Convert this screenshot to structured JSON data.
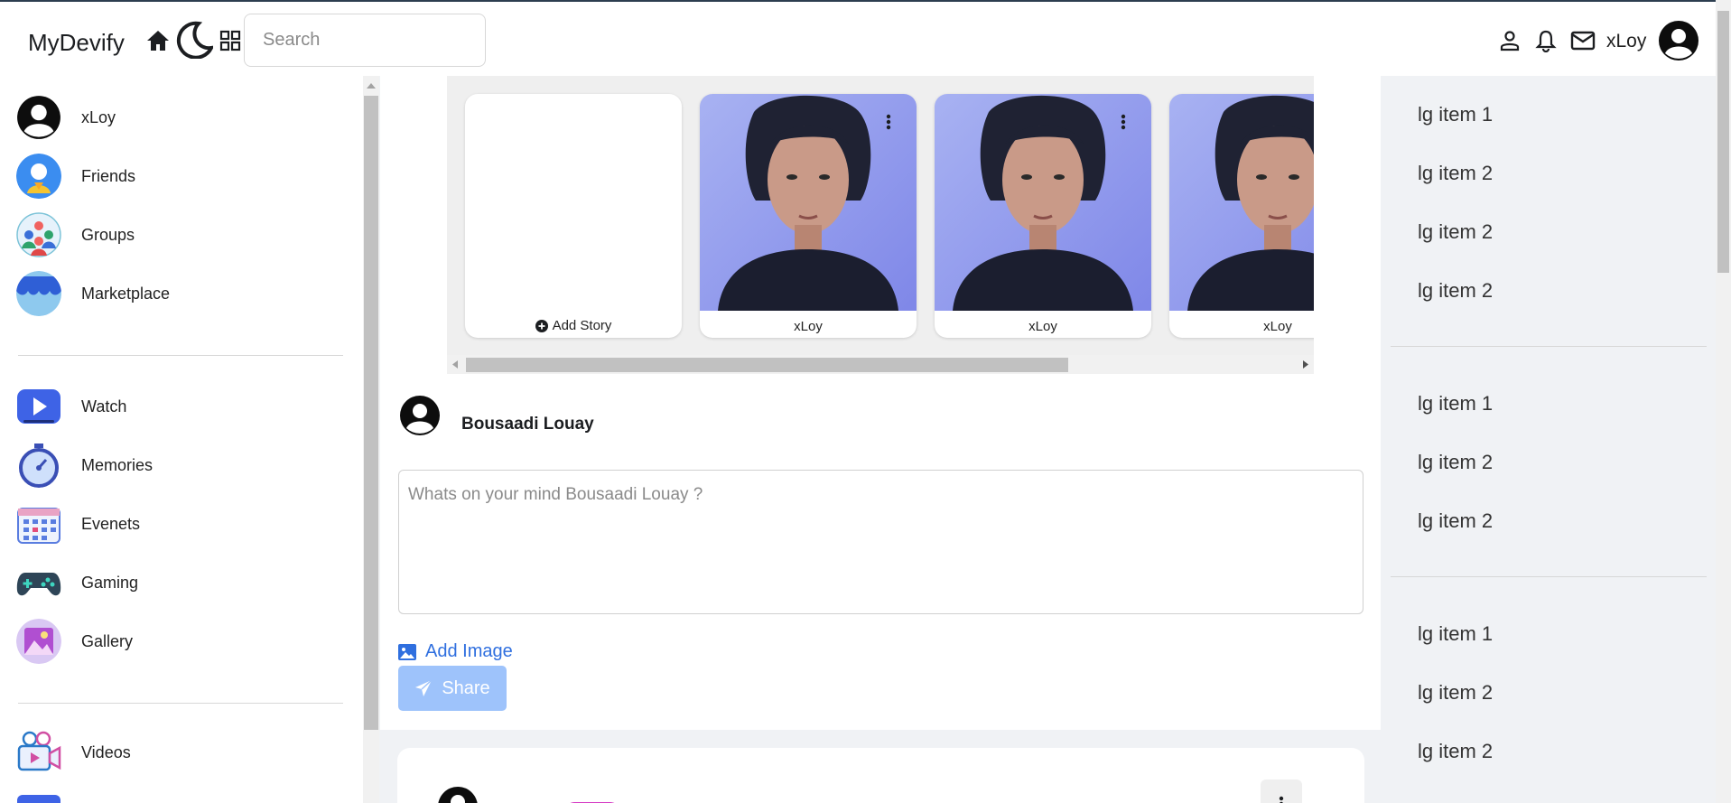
{
  "header": {
    "brand": "MyDevify",
    "search_placeholder": "Search",
    "username": "xLoy",
    "icons": [
      "home-icon",
      "moon-icon",
      "apps-grid-icon",
      "person-icon",
      "bell-icon",
      "mail-icon",
      "avatar-icon"
    ]
  },
  "sidebar": {
    "items": [
      {
        "label": "xLoy",
        "icon": "user-avatar"
      },
      {
        "label": "Friends",
        "icon": "friends-icon"
      },
      {
        "label": "Groups",
        "icon": "groups-icon"
      },
      {
        "label": "Marketplace",
        "icon": "marketplace-icon"
      },
      {
        "label": "Watch",
        "icon": "watch-icon"
      },
      {
        "label": "Memories",
        "icon": "memories-icon"
      },
      {
        "label": "Evenets",
        "icon": "events-icon"
      },
      {
        "label": "Gaming",
        "icon": "gaming-icon"
      },
      {
        "label": "Gallery",
        "icon": "gallery-icon"
      },
      {
        "label": "Videos",
        "icon": "videos-icon"
      }
    ]
  },
  "stories": {
    "add_label": "Add Story",
    "items": [
      {
        "name": "xLoy"
      },
      {
        "name": "xLoy"
      },
      {
        "name": "xLoy"
      }
    ]
  },
  "composer": {
    "author": "Bousaadi Louay",
    "placeholder": "Whats on your mind Bousaadi Louay ?",
    "add_image_label": "Add Image",
    "share_label": "Share"
  },
  "rightbar": {
    "groups": [
      [
        "lg item 1",
        "lg item 2",
        "lg item 2",
        "lg item 2"
      ],
      [
        "lg item 1",
        "lg item 2",
        "lg item 2"
      ],
      [
        "lg item 1",
        "lg item 2",
        "lg item 2"
      ]
    ]
  },
  "colors": {
    "accent": "#2f6fdf",
    "share_button": "#9ec3fb",
    "background": "#f0f2f5"
  }
}
